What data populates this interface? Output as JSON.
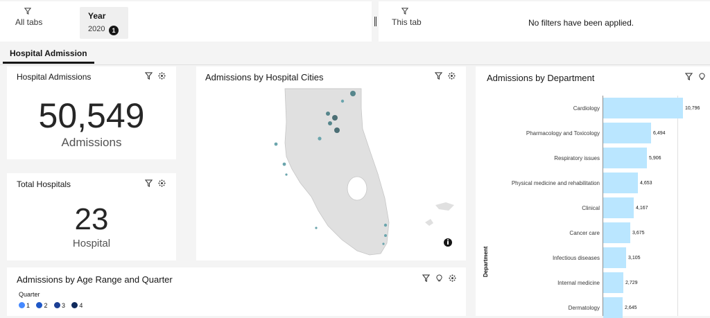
{
  "filters": {
    "all_tabs_label": "All tabs",
    "year_label": "Year",
    "year_value": "2020",
    "year_count": "1",
    "this_tab_label": "This tab",
    "no_filters_text": "No filters have been applied."
  },
  "tabs": [
    {
      "label": "Hospital Admission",
      "active": true
    }
  ],
  "cards": {
    "admissions": {
      "title": "Hospital Admissions",
      "value": "50,549",
      "unit": "Admissions"
    },
    "hospitals": {
      "title": "Total Hospitals",
      "value": "23",
      "unit": "Hospital"
    },
    "map": {
      "title": "Admissions by Hospital Cities"
    },
    "age": {
      "title": "Admissions by Age Range and Quarter",
      "legend_title": "Quarter",
      "legend": [
        "1",
        "2",
        "3",
        "4"
      ]
    },
    "dept": {
      "title": "Admissions by Department",
      "axis_label": "Department"
    }
  },
  "icons": {
    "filter": "filter-icon",
    "cluster": "cluster-icon",
    "bulb": "lightbulb-icon",
    "info": "info-icon"
  },
  "colors": {
    "bar": "#bae6ff",
    "legend": [
      "#4589ff",
      "#1f58c7",
      "#1c3f94",
      "#0f2a5c"
    ],
    "map_land": "#e0e0e0",
    "map_dot": "#56868c"
  },
  "chart_data": {
    "type": "bar",
    "orientation": "horizontal",
    "title": "Admissions by Department",
    "ylabel": "Department",
    "categories": [
      "Cardiology",
      "Pharmacology and Toxicology",
      "Respiratory issues",
      "Physical medicine and rehabilitation",
      "Clinical",
      "Cancer care",
      "Infectious diseases",
      "Internal medicine",
      "Dermatology"
    ],
    "values": [
      10796,
      6494,
      5906,
      4653,
      4167,
      3675,
      3105,
      2729,
      2645
    ],
    "value_labels": [
      "10,796",
      "6,494",
      "5,906",
      "4,653",
      "4,167",
      "3,675",
      "3,105",
      "2,729",
      "2,645"
    ],
    "xlim": [
      0,
      12500
    ]
  }
}
